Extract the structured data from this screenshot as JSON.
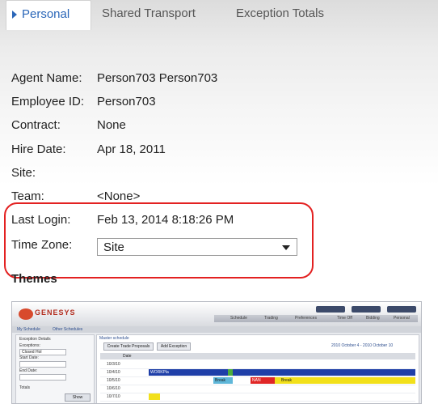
{
  "tabs": [
    {
      "label": "Personal",
      "active": true
    },
    {
      "label": "Shared Transport",
      "active": false
    },
    {
      "label": "Exception Totals",
      "active": false
    }
  ],
  "fields": {
    "agent_name": {
      "label": "Agent Name:",
      "value": "Person703 Person703"
    },
    "employee_id": {
      "label": "Employee ID:",
      "value": "Person703"
    },
    "contract": {
      "label": "Contract:",
      "value": "None"
    },
    "hire_date": {
      "label": "Hire Date:",
      "value": "Apr 18, 2011"
    },
    "site": {
      "label": "Site:",
      "value": ""
    },
    "team": {
      "label": "Team:",
      "value": "<None>"
    },
    "last_login": {
      "label": "Last Login:",
      "value": "Feb 13, 2014 8:18:26 PM"
    },
    "time_zone": {
      "label": "Time Zone:",
      "value": "Site"
    }
  },
  "themes": {
    "title": "Themes",
    "preview": {
      "logo": "GENESYS",
      "nav_items": [
        "Schedule",
        "Trading",
        "Preferences",
        "Time Off",
        "Bidding",
        "Personal"
      ],
      "tabs": [
        "My Schedule",
        "Other Schedules"
      ],
      "left_labels": [
        "Exception Details",
        "Exceptions:",
        "Start Date:",
        "End Date:",
        "Totals"
      ],
      "left_select": "Closed Hol",
      "left_button": "Show",
      "main_header": "Master schedule",
      "buttons": [
        "Create Trade Proposals",
        "Add Exception"
      ],
      "date_range": "2010 October 4 - 2010 October 10",
      "grid_header": "Date",
      "rows": [
        "10/3/10",
        "10/4/10",
        "10/5/10",
        "10/6/10",
        "10/7/10"
      ],
      "bar_labels": [
        "WORKPla",
        "Break",
        "NAN",
        "Break"
      ]
    }
  },
  "colors": {
    "accent": "#2a66b8",
    "highlight_outline": "#e32121"
  },
  "icons": {
    "active_tab": "triangle-right-icon",
    "select": "chevron-down-icon"
  }
}
